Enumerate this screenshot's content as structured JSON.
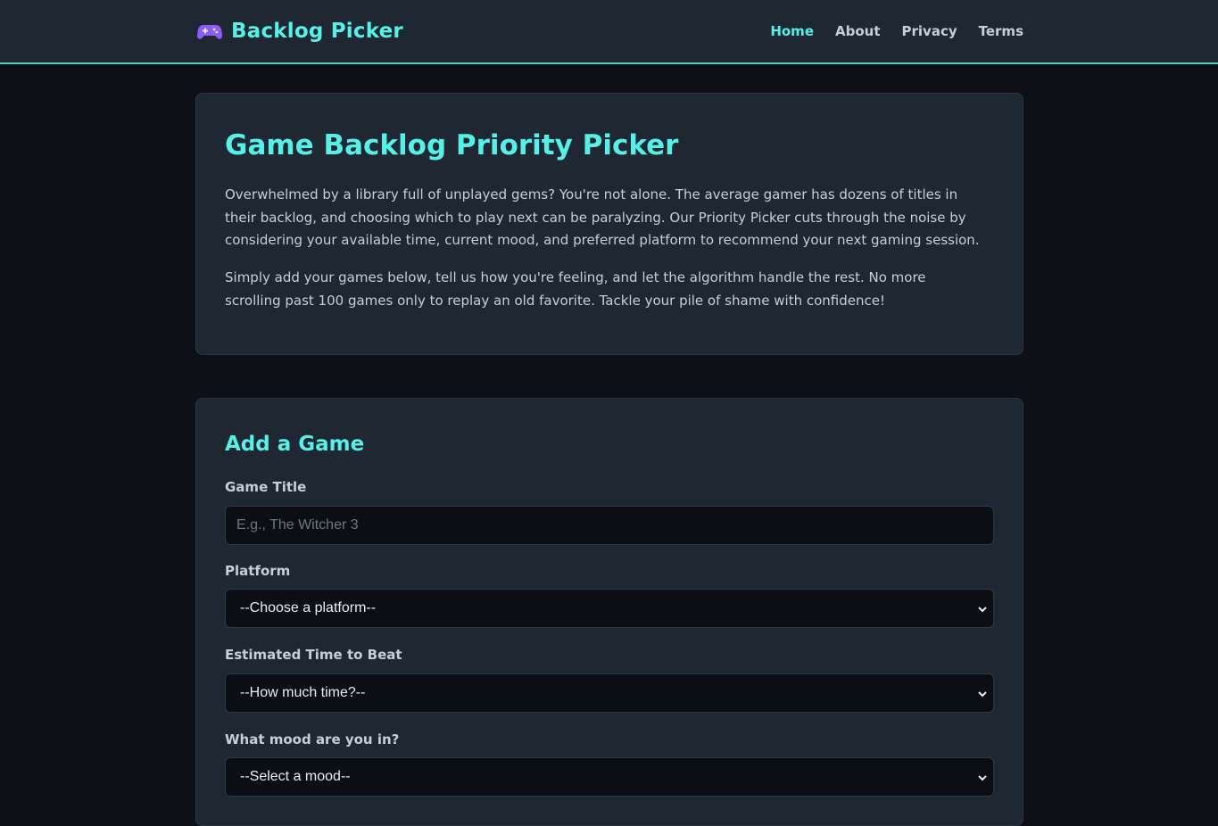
{
  "header": {
    "brand_icon": "gamepad-icon",
    "brand_title": "Backlog Picker",
    "nav": [
      {
        "label": "Home",
        "active": true
      },
      {
        "label": "About",
        "active": false
      },
      {
        "label": "Privacy",
        "active": false
      },
      {
        "label": "Terms",
        "active": false
      }
    ]
  },
  "intro": {
    "title": "Game Backlog Priority Picker",
    "paragraph1": "Overwhelmed by a library full of unplayed gems? You're not alone. The average gamer has dozens of titles in their backlog, and choosing which to play next can be paralyzing. Our Priority Picker cuts through the noise by considering your available time, current mood, and preferred platform to recommend your next gaming session.",
    "paragraph2": "Simply add your games below, tell us how you're feeling, and let the algorithm handle the rest. No more scrolling past 100 games only to replay an old favorite. Tackle your pile of shame with confidence!"
  },
  "form": {
    "title": "Add a Game",
    "game_title": {
      "label": "Game Title",
      "value": "",
      "placeholder": "E.g., The Witcher 3"
    },
    "platform": {
      "label": "Platform",
      "selected": "--Choose a platform--"
    },
    "time": {
      "label": "Estimated Time to Beat",
      "selected": "--How much time?--"
    },
    "mood": {
      "label": "What mood are you in?",
      "selected": "--Select a mood--"
    }
  },
  "colors": {
    "accent": "#56f0e6",
    "background": "#0d1117",
    "card": "#1e2732",
    "input_bg": "#0b0e12",
    "brand_icon": "#8b5cf6"
  }
}
